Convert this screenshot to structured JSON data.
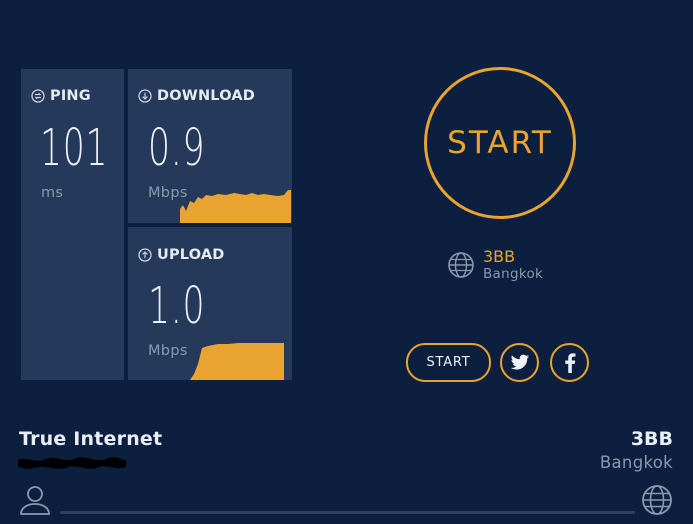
{
  "ping": {
    "label": "PING",
    "value": "101",
    "unit": "ms"
  },
  "download": {
    "label": "DOWNLOAD",
    "value": "0.9",
    "unit": "Mbps"
  },
  "upload": {
    "label": "UPLOAD",
    "value": "1.0",
    "unit": "Mbps"
  },
  "start": {
    "main_label": "START",
    "small_label": "START"
  },
  "server": {
    "name": "3BB",
    "city": "Bangkok"
  },
  "isp": {
    "name": "True Internet"
  },
  "host": {
    "name": "3BB",
    "city": "Bangkok"
  },
  "colors": {
    "background": "#0c1f3e",
    "panel": "#25395a",
    "accent": "#e8a331",
    "muted": "#8c99ad"
  },
  "icons": [
    "ping-icon",
    "download-icon",
    "upload-icon",
    "globe-icon",
    "twitter-icon",
    "facebook-icon",
    "user-icon"
  ]
}
